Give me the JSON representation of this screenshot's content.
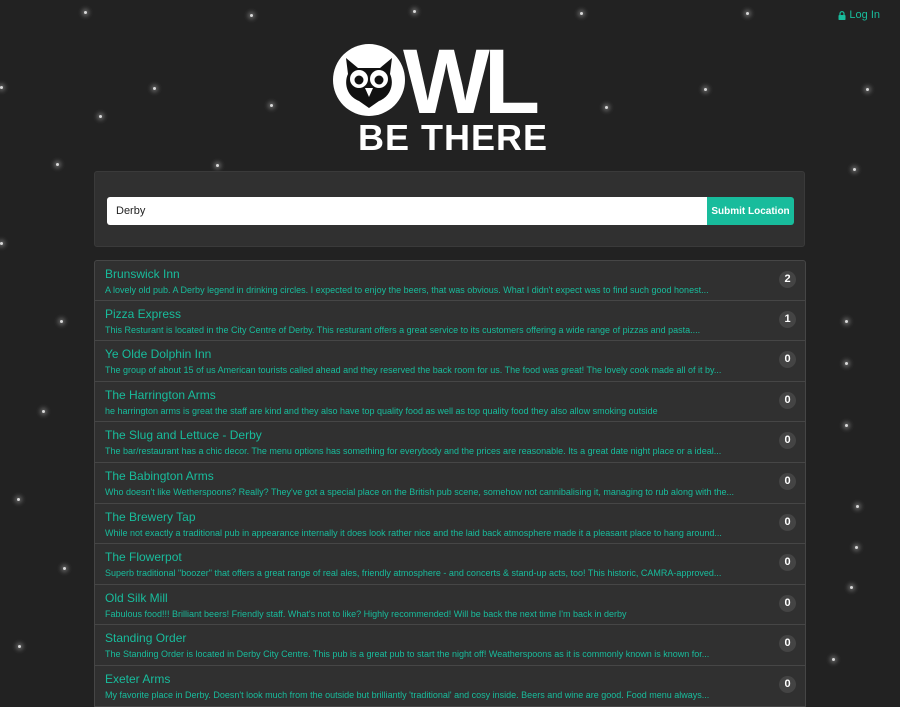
{
  "header": {
    "login_label": "Log In"
  },
  "logo": {
    "top_text": "WL",
    "sub_text": "BE THERE"
  },
  "search": {
    "value": "Derby",
    "submit_label": "Submit Location"
  },
  "colors": {
    "accent": "#18bc9c",
    "background": "#222222",
    "panel": "#303030"
  },
  "results": [
    {
      "name": "Brunswick Inn",
      "description": "A lovely old pub. A Derby legend in drinking circles. I expected to enjoy the beers, that was obvious. What I didn't expect was to find such good honest...",
      "count": "2"
    },
    {
      "name": "Pizza Express",
      "description": "This Resturant is located in the City Centre of Derby. This resturant offers a great service to its customers offering a wide range of pizzas and pasta....",
      "count": "1"
    },
    {
      "name": "Ye Olde Dolphin Inn",
      "description": "The group of about 15 of us American tourists called ahead and they reserved the back room for us. The food was great! The lovely cook made all of it by...",
      "count": "0"
    },
    {
      "name": "The Harrington Arms",
      "description": "he harrington arms is great the staff are kind and they also have top quality food as well as top quality food they also allow smoking outside",
      "count": "0"
    },
    {
      "name": "The Slug and Lettuce - Derby",
      "description": "The bar/restaurant has a chic decor. The menu options has something for everybody and the prices are reasonable. Its a great date night place or a ideal...",
      "count": "0"
    },
    {
      "name": "The Babington Arms",
      "description": "Who doesn't like Wetherspoons? Really? They've got a special place on the British pub scene, somehow not cannibalising it, managing to rub along with the...",
      "count": "0"
    },
    {
      "name": "The Brewery Tap",
      "description": "While not exactly a traditional pub in appearance internally it does look rather nice and the laid back atmosphere made it a pleasant place to hang around...",
      "count": "0"
    },
    {
      "name": "The Flowerpot",
      "description": "Superb traditional \"boozer\" that offers a great range of real ales, friendly atmosphere - and concerts & stand-up acts, too! This historic, CAMRA-approved...",
      "count": "0"
    },
    {
      "name": "Old Silk Mill",
      "description": "Fabulous food!!! Brilliant beers! Friendly staff. What's not to like? Highly recommended! Will be back the next time I'm back in derby",
      "count": "0"
    },
    {
      "name": "Standing Order",
      "description": "The Standing Order is located in Derby City Centre. This pub is a great pub to start the night off! Weatherspoons as it is commonly known is known for...",
      "count": "0"
    },
    {
      "name": "Exeter Arms",
      "description": "My favorite place in Derby. Doesn't look much from the outside but brilliantly 'traditional' and cosy inside. Beers and wine are good. Food menu always...",
      "count": "0"
    }
  ]
}
